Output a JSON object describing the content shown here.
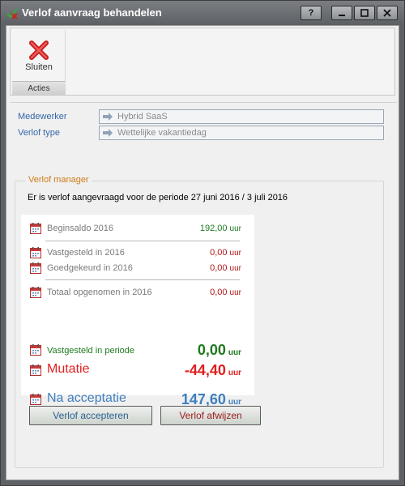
{
  "window": {
    "title": "Verlof aanvraag behandelen"
  },
  "titlebar_buttons": {
    "help": "?"
  },
  "ribbon": {
    "close_label": "Sluiten",
    "group_label": "Acties"
  },
  "fields": {
    "medewerker": {
      "label": "Medewerker",
      "value": "Hybrid SaaS"
    },
    "verlof_type": {
      "label": "Verlof type",
      "value": "Wettelijke vakantiedag"
    }
  },
  "verlof_manager": {
    "legend": "Verlof manager",
    "description": "Er is verlof aangevraagd voor de periode 27 juni 2016 / 3 juli 2016",
    "rows": [
      {
        "label": "Beginsaldo 2016",
        "value": "192,00",
        "unit": "uur",
        "color": "#1f7a1f"
      },
      {
        "label": "Vastgesteld in 2016",
        "value": "0,00",
        "unit": "uur",
        "color": "#b21818"
      },
      {
        "label": "Goedgekeurd in 2016",
        "value": "0,00",
        "unit": "uur",
        "color": "#b21818"
      },
      {
        "label": "Totaal opgenomen in 2016",
        "value": "0,00",
        "unit": "uur",
        "color": "#b21818"
      },
      {
        "label": "Vastgesteld in periode",
        "value": "0,00",
        "unit": "uur",
        "color": "#1f7a1f"
      },
      {
        "label": "Mutatie",
        "value": "-44,40",
        "unit": "uur",
        "color": "#e02020"
      },
      {
        "label": "Na acceptatie",
        "value": "147,60",
        "unit": "uur",
        "color": "#3f7fbf"
      }
    ]
  },
  "buttons": {
    "accept": "Verlof accepteren",
    "reject": "Verlof afwijzen"
  },
  "icons": [
    "app-icon",
    "close-icon",
    "arrow-right-icon",
    "calendar-icon"
  ],
  "colors": {
    "legend": "#d07a17",
    "field_label": "#3366a8",
    "accept_text": "#2a5f8f",
    "reject_text": "#9b1c1c"
  }
}
